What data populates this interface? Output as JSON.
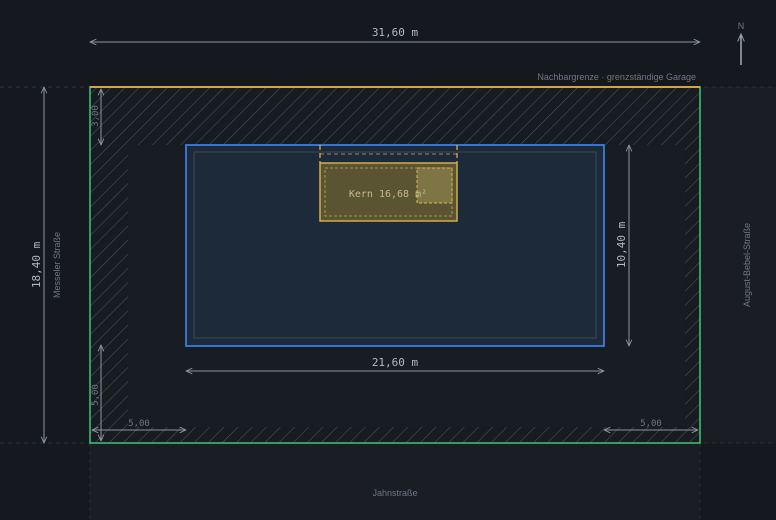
{
  "plan": {
    "north_label": "N",
    "labels": {
      "neighbor": "Nachbargrenze · grenzständige Garage",
      "street_west": "Messeler Straße",
      "street_east": "August-Bebel-Straße",
      "street_south": "Jahnstraße"
    },
    "dimensions": {
      "plot_width": "31,60 m",
      "plot_depth": "18,40 m",
      "building_width": "21,60 m",
      "building_depth": "10,40 m",
      "setback_north": "3,00",
      "setback_south": "5,00",
      "setback_west": "5,00",
      "setback_east": "5,00"
    },
    "core": {
      "label": "Kern 16,68 m²"
    },
    "colors": {
      "background": "#15181e",
      "plot_boundary": "#3dbb76",
      "neighbor_boundary": "#d9a538",
      "building": "#3b7ddd",
      "building_fill": "#1d2a3a",
      "core": "#d8b94a",
      "hatch": "#3f5a44",
      "dimension": "#8d95a2"
    }
  }
}
